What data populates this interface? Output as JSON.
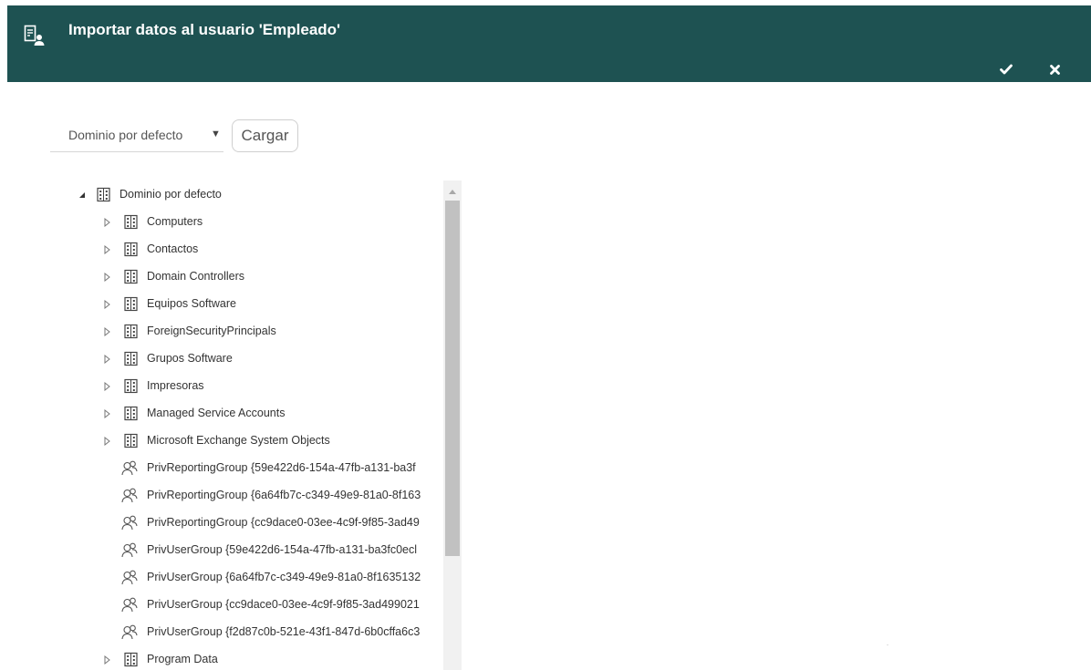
{
  "header": {
    "title": "Importar datos al usuario 'Empleado'",
    "icon": "user-document-icon",
    "confirm_icon": "check-icon",
    "close_icon": "close-icon",
    "background": "#1e5252"
  },
  "toolbar": {
    "domain_select_value": "Dominio por defecto",
    "load_label": "Cargar"
  },
  "tree": {
    "root": {
      "label": "Dominio por defecto",
      "icon": "building-icon",
      "expanded": true
    },
    "items": [
      {
        "label": "Computers",
        "icon": "building-icon",
        "expandable": true
      },
      {
        "label": "Contactos",
        "icon": "building-icon",
        "expandable": true
      },
      {
        "label": "Domain Controllers",
        "icon": "building-icon",
        "expandable": true
      },
      {
        "label": "Equipos Software",
        "icon": "building-icon",
        "expandable": true
      },
      {
        "label": "ForeignSecurityPrincipals",
        "icon": "building-icon",
        "expandable": true
      },
      {
        "label": "Grupos Software",
        "icon": "building-icon",
        "expandable": true
      },
      {
        "label": "Impresoras",
        "icon": "building-icon",
        "expandable": true
      },
      {
        "label": "Managed Service Accounts",
        "icon": "building-icon",
        "expandable": true
      },
      {
        "label": "Microsoft Exchange System Objects",
        "icon": "building-icon",
        "expandable": true
      },
      {
        "label": "PrivReportingGroup {59e422d6-154a-47fb-a131-ba3f",
        "icon": "group-icon",
        "expandable": false
      },
      {
        "label": "PrivReportingGroup {6a64fb7c-c349-49e9-81a0-8f163",
        "icon": "group-icon",
        "expandable": false
      },
      {
        "label": "PrivReportingGroup {cc9dace0-03ee-4c9f-9f85-3ad49",
        "icon": "group-icon",
        "expandable": false
      },
      {
        "label": "PrivUserGroup {59e422d6-154a-47fb-a131-ba3fc0ecl",
        "icon": "group-icon",
        "expandable": false
      },
      {
        "label": "PrivUserGroup {6a64fb7c-c349-49e9-81a0-8f1635132",
        "icon": "group-icon",
        "expandable": false
      },
      {
        "label": "PrivUserGroup {cc9dace0-03ee-4c9f-9f85-3ad499021",
        "icon": "group-icon",
        "expandable": false
      },
      {
        "label": "PrivUserGroup {f2d87c0b-521e-43f1-847d-6b0cffa6c3",
        "icon": "group-icon",
        "expandable": false
      },
      {
        "label": "Program Data",
        "icon": "building-icon",
        "expandable": true
      }
    ]
  }
}
